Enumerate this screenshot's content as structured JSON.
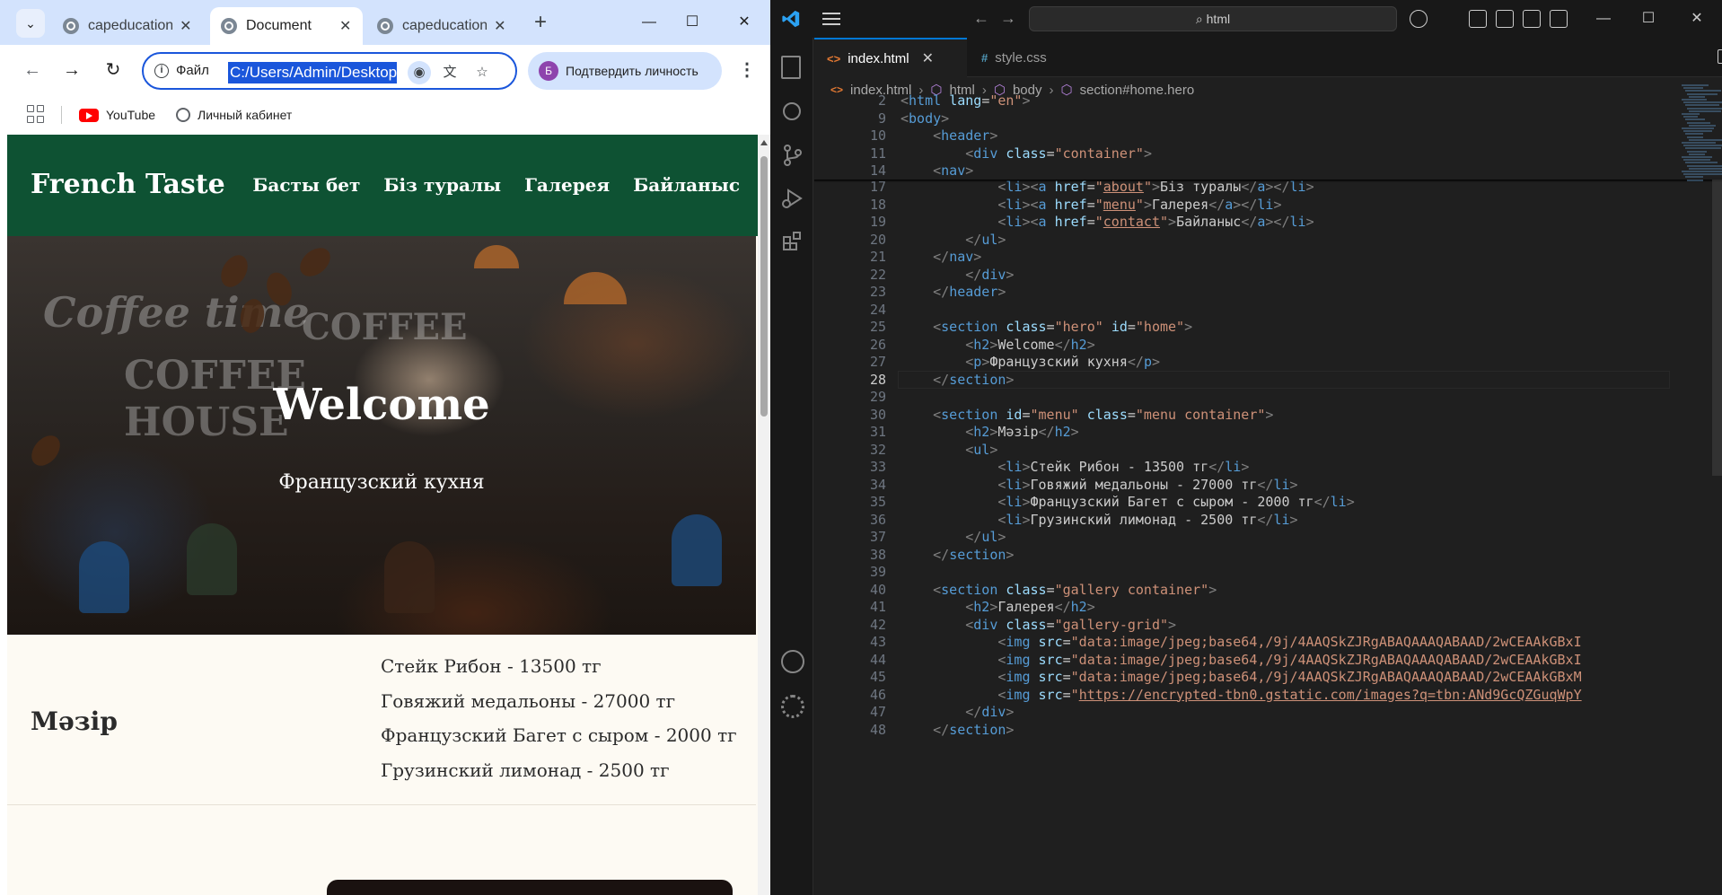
{
  "chrome": {
    "tabs": [
      {
        "title": "capeducation",
        "active": false
      },
      {
        "title": "Document",
        "active": true
      },
      {
        "title": "capeducation",
        "active": false
      }
    ],
    "new_tab": "+",
    "omnibox": {
      "scheme_label": "Файл",
      "url": "C:/Users/Admin/Desktop"
    },
    "profile": {
      "avatar_letter": "Б",
      "label": "Подтвердить личность"
    },
    "bookmarks": [
      {
        "label": "YouTube"
      },
      {
        "label": "Личный кабинет"
      }
    ]
  },
  "site": {
    "logo": "French Taste",
    "nav": [
      "Басты бет",
      "Біз туралы",
      "Галерея",
      "Байланыс"
    ],
    "hero": {
      "title": "Welcome",
      "subtitle": "Французский кухня",
      "bg_text": [
        "Coffee time",
        "COFFEE",
        "COFFEE HOUSE"
      ]
    },
    "menu": {
      "heading": "Мәзір",
      "items": [
        "Стейк Рибон - 13500 тг",
        "Говяжий медальоны - 27000 тг",
        "Французский Багет с сыром - 2000 тг",
        "Грузинский лимонад - 2500 тг"
      ]
    },
    "colors": {
      "header_bg": "#0e5233",
      "page_bg": "#fdfaf3"
    }
  },
  "vscode": {
    "command_center": "html",
    "tabs": [
      {
        "label": "index.html",
        "icon": "<>",
        "active": true
      },
      {
        "label": "style.css",
        "icon": "#",
        "active": false
      }
    ],
    "breadcrumb": [
      "index.html",
      "html",
      "body",
      "section#home.hero"
    ],
    "sticky_lines": [
      {
        "n": "2",
        "html": "<span class='t-ang'>&lt;</span><span class='t-tag'>html</span> <span class='t-attr'>lang</span>=<span class='t-str'>\"en\"</span><span class='t-ang'>&gt;</span>"
      },
      {
        "n": "9",
        "html": "<span class='t-ang'>&lt;</span><span class='t-tag'>body</span><span class='t-ang'>&gt;</span>"
      },
      {
        "n": "10",
        "html": "    <span class='t-ang'>&lt;</span><span class='t-tag'>header</span><span class='t-ang'>&gt;</span>"
      },
      {
        "n": "11",
        "html": "        <span class='t-ang'>&lt;</span><span class='t-tag'>div</span> <span class='t-attr'>class</span>=<span class='t-str'>\"container\"</span><span class='t-ang'>&gt;</span>"
      },
      {
        "n": "14",
        "html": "    <span class='t-ang'>&lt;</span><span class='t-tag'>nav</span><span class='t-ang'>&gt;</span>"
      }
    ],
    "lines": [
      {
        "n": "17",
        "html": "            <span class='t-ang'>&lt;</span><span class='t-tag'>li</span><span class='t-ang'>&gt;&lt;</span><span class='t-tag'>a</span> <span class='t-attr'>href</span>=<span class='t-str'>\"<u>about</u>\"</span><span class='t-ang'>&gt;</span><span class='t-txt'>Біз туралы</span><span class='t-ang'>&lt;/</span><span class='t-tag'>a</span><span class='t-ang'>&gt;&lt;/</span><span class='t-tag'>li</span><span class='t-ang'>&gt;</span>"
      },
      {
        "n": "18",
        "html": "            <span class='t-ang'>&lt;</span><span class='t-tag'>li</span><span class='t-ang'>&gt;&lt;</span><span class='t-tag'>a</span> <span class='t-attr'>href</span>=<span class='t-str'>\"<u>menu</u>\"</span><span class='t-ang'>&gt;</span><span class='t-txt'>Галерея</span><span class='t-ang'>&lt;/</span><span class='t-tag'>a</span><span class='t-ang'>&gt;&lt;/</span><span class='t-tag'>li</span><span class='t-ang'>&gt;</span>"
      },
      {
        "n": "19",
        "html": "            <span class='t-ang'>&lt;</span><span class='t-tag'>li</span><span class='t-ang'>&gt;&lt;</span><span class='t-tag'>a</span> <span class='t-attr'>href</span>=<span class='t-str'>\"<u>contact</u>\"</span><span class='t-ang'>&gt;</span><span class='t-txt'>Байланыс</span><span class='t-ang'>&lt;/</span><span class='t-tag'>a</span><span class='t-ang'>&gt;&lt;/</span><span class='t-tag'>li</span><span class='t-ang'>&gt;</span>"
      },
      {
        "n": "20",
        "html": "        <span class='t-ang'>&lt;/</span><span class='t-tag'>ul</span><span class='t-ang'>&gt;</span>"
      },
      {
        "n": "21",
        "html": "    <span class='t-ang'>&lt;/</span><span class='t-tag'>nav</span><span class='t-ang'>&gt;</span>"
      },
      {
        "n": "22",
        "html": "        <span class='t-ang'>&lt;/</span><span class='t-tag'>div</span><span class='t-ang'>&gt;</span>"
      },
      {
        "n": "23",
        "html": "    <span class='t-ang'>&lt;/</span><span class='t-tag'>header</span><span class='t-ang'>&gt;</span>"
      },
      {
        "n": "24",
        "html": ""
      },
      {
        "n": "25",
        "html": "    <span class='t-ang'>&lt;</span><span class='t-tag'>section</span> <span class='t-attr'>class</span>=<span class='t-str'>\"hero\"</span> <span class='t-attr'>id</span>=<span class='t-str'>\"home\"</span><span class='t-ang'>&gt;</span>"
      },
      {
        "n": "26",
        "html": "        <span class='t-ang'>&lt;</span><span class='t-tag'>h2</span><span class='t-ang'>&gt;</span><span class='t-txt'>Welcome</span><span class='t-ang'>&lt;/</span><span class='t-tag'>h2</span><span class='t-ang'>&gt;</span>"
      },
      {
        "n": "27",
        "html": "        <span class='t-ang'>&lt;</span><span class='t-tag'>p</span><span class='t-ang'>&gt;</span><span class='t-txt'>Французский кухня</span><span class='t-ang'>&lt;/</span><span class='t-tag'>p</span><span class='t-ang'>&gt;</span>"
      },
      {
        "n": "28",
        "html": "    <span class='t-ang'>&lt;/</span><span class='t-tag'>section</span><span class='t-ang'>&gt;</span>",
        "current": true
      },
      {
        "n": "29",
        "html": ""
      },
      {
        "n": "30",
        "html": "    <span class='t-ang'>&lt;</span><span class='t-tag'>section</span> <span class='t-attr'>id</span>=<span class='t-str'>\"menu\"</span> <span class='t-attr'>class</span>=<span class='t-str'>\"menu container\"</span><span class='t-ang'>&gt;</span>"
      },
      {
        "n": "31",
        "html": "        <span class='t-ang'>&lt;</span><span class='t-tag'>h2</span><span class='t-ang'>&gt;</span><span class='t-txt'>Мәзір</span><span class='t-ang'>&lt;/</span><span class='t-tag'>h2</span><span class='t-ang'>&gt;</span>"
      },
      {
        "n": "32",
        "html": "        <span class='t-ang'>&lt;</span><span class='t-tag'>ul</span><span class='t-ang'>&gt;</span>"
      },
      {
        "n": "33",
        "html": "            <span class='t-ang'>&lt;</span><span class='t-tag'>li</span><span class='t-ang'>&gt;</span><span class='t-txt'>Стейк Рибон - 13500 тг</span><span class='t-ang'>&lt;/</span><span class='t-tag'>li</span><span class='t-ang'>&gt;</span>"
      },
      {
        "n": "34",
        "html": "            <span class='t-ang'>&lt;</span><span class='t-tag'>li</span><span class='t-ang'>&gt;</span><span class='t-txt'>Говяжий медальоны - 27000 тг</span><span class='t-ang'>&lt;/</span><span class='t-tag'>li</span><span class='t-ang'>&gt;</span>"
      },
      {
        "n": "35",
        "html": "            <span class='t-ang'>&lt;</span><span class='t-tag'>li</span><span class='t-ang'>&gt;</span><span class='t-txt'>Французский Багет с сыром - 2000 тг</span><span class='t-ang'>&lt;/</span><span class='t-tag'>li</span><span class='t-ang'>&gt;</span>"
      },
      {
        "n": "36",
        "html": "            <span class='t-ang'>&lt;</span><span class='t-tag'>li</span><span class='t-ang'>&gt;</span><span class='t-txt'>Грузинский лимонад - 2500 тг</span><span class='t-ang'>&lt;/</span><span class='t-tag'>li</span><span class='t-ang'>&gt;</span>"
      },
      {
        "n": "37",
        "html": "        <span class='t-ang'>&lt;/</span><span class='t-tag'>ul</span><span class='t-ang'>&gt;</span>"
      },
      {
        "n": "38",
        "html": "    <span class='t-ang'>&lt;/</span><span class='t-tag'>section</span><span class='t-ang'>&gt;</span>"
      },
      {
        "n": "39",
        "html": ""
      },
      {
        "n": "40",
        "html": "    <span class='t-ang'>&lt;</span><span class='t-tag'>section</span> <span class='t-attr'>class</span>=<span class='t-str'>\"gallery container\"</span><span class='t-ang'>&gt;</span>"
      },
      {
        "n": "41",
        "html": "        <span class='t-ang'>&lt;</span><span class='t-tag'>h2</span><span class='t-ang'>&gt;</span><span class='t-txt'>Галерея</span><span class='t-ang'>&lt;/</span><span class='t-tag'>h2</span><span class='t-ang'>&gt;</span>"
      },
      {
        "n": "42",
        "html": "        <span class='t-ang'>&lt;</span><span class='t-tag'>div</span> <span class='t-attr'>class</span>=<span class='t-str'>\"gallery-grid\"</span><span class='t-ang'>&gt;</span>"
      },
      {
        "n": "43",
        "html": "            <span class='t-ang'>&lt;</span><span class='t-tag'>img</span> <span class='t-attr'>src</span>=<span class='t-str'>\"data:image/jpeg;base64,/9j/4AAQSkZJRgABAQAAAQABAAD/2wCEAAkGBxI</span>"
      },
      {
        "n": "44",
        "html": "            <span class='t-ang'>&lt;</span><span class='t-tag'>img</span> <span class='t-attr'>src</span>=<span class='t-str'>\"data:image/jpeg;base64,/9j/4AAQSkZJRgABAQAAAQABAAD/2wCEAAkGBxI</span>"
      },
      {
        "n": "45",
        "html": "            <span class='t-ang'>&lt;</span><span class='t-tag'>img</span> <span class='t-attr'>src</span>=<span class='t-str'>\"data:image/jpeg;base64,/9j/4AAQSkZJRgABAQAAAQABAAD/2wCEAAkGBxM</span>"
      },
      {
        "n": "46",
        "html": "            <span class='t-ang'>&lt;</span><span class='t-tag'>img</span> <span class='t-attr'>src</span>=<span class='t-str'>\"<span class='t-link'>https://encrypted-tbn0.gstatic.com/images?q=tbn:ANd9GcQZGuqWpY</span></span>"
      },
      {
        "n": "47",
        "html": "        <span class='t-ang'>&lt;/</span><span class='t-tag'>div</span><span class='t-ang'>&gt;</span>"
      },
      {
        "n": "48",
        "html": "    <span class='t-ang'>&lt;/</span><span class='t-tag'>section</span><span class='t-ang'>&gt;</span>"
      }
    ]
  }
}
